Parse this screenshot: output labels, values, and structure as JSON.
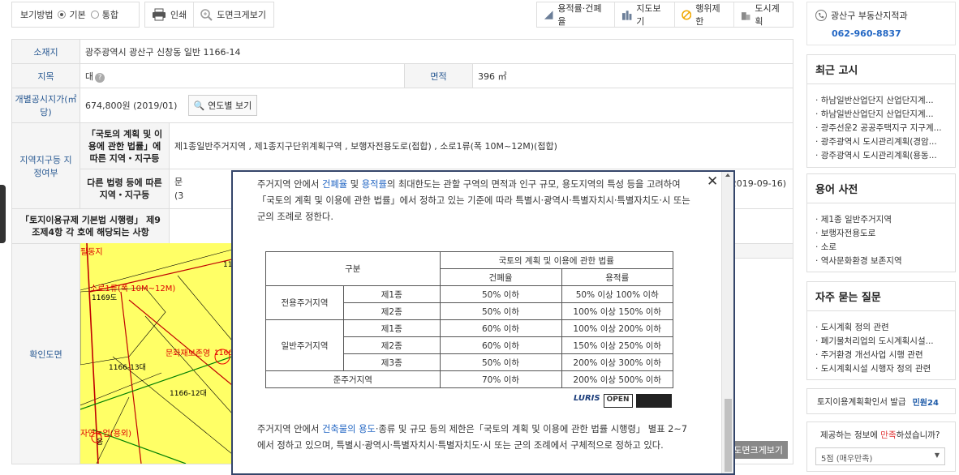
{
  "toolbar": {
    "view_mode_label": "보기방법",
    "view_basic": "기본",
    "view_combined": "통합",
    "print": "인쇄",
    "map_zoom": "도면크게보기",
    "calc": "용적률·건폐율",
    "map_view": "지도보기",
    "restriction": "행위제한",
    "city_plan": "도시계획"
  },
  "info": {
    "location_label": "소재지",
    "location_value": "광주광역시 광산구 신창동 일반 1166-14",
    "jimok_label": "지목",
    "jimok_value": "대",
    "area_label": "면적",
    "area_value": "396 ㎡",
    "price_label": "개별공시지가(㎡ 당)",
    "price_value": "674,800원 (2019/01)",
    "yearly_btn": "연도별 보기",
    "zone_label": "지역지구등 지정여부",
    "law1_label": "「국토의 계획 및 이용에 관한 법률」에 따른 지역・지구등",
    "law1_value": "제1종일반주거지역 , 제1종지구단위계획구역 , 보행자전용도로(접합) , 소로1류(폭 10M~12M)(접합)",
    "law2_label": "다른 법령 등에 따른 지역・지구등",
    "law2_value_a": "문",
    "law2_value_b": "(3",
    "law2_date": "2019-09-16)",
    "decree_label": "「토지이용규제 기본법 시행령」 제9조제4항 각 호에 해당되는 사항",
    "confirm_map_label": "확인도면",
    "map_zoom_btn": "도면크게보기"
  },
  "map_labels": {
    "a": "필동지",
    "b": "소로1류(폭 10M~12M)",
    "c": "1169도",
    "d": "1166-13대",
    "e": "1166-12대",
    "f": "문화재보존영",
    "g": "11",
    "h": "1166",
    "i": "자연녹업(용외)",
    "j": "응"
  },
  "modal": {
    "close_label": "✕",
    "p1_a": "주거지역 안에서 ",
    "p1_b": "건폐율",
    "p1_c": " 및 ",
    "p1_d": "용적률",
    "p1_e": "의 최대한도는 관할 구역의 면적과 인구 규모, 용도지역의 특성 등을 고려하여「국토의 계획 및 이용에 관한 법률」에서 정하고 있는 기준에 따라 특별시·광역시·특별자치시·특별자치도·시 또는 군의 조례로 정한다.",
    "table": {
      "h_category": "구분",
      "h_law": "국토의 계획 및 이용에 관한 법률",
      "h_bcr": "건폐율",
      "h_far": "용적률",
      "rows": [
        {
          "group": "전용주거지역",
          "sub": "제1종",
          "bcr": "50% 이하",
          "far": "50% 이상 100% 이하"
        },
        {
          "group": "",
          "sub": "제2종",
          "bcr": "50% 이하",
          "far": "100% 이상 150% 이하"
        },
        {
          "group": "일반주거지역",
          "sub": "제1종",
          "bcr": "60% 이하",
          "far": "100% 이상 200% 이하"
        },
        {
          "group": "",
          "sub": "제2종",
          "bcr": "60% 이하",
          "far": "150% 이상 250% 이하"
        },
        {
          "group": "",
          "sub": "제3종",
          "bcr": "50% 이하",
          "far": "200% 이상 300% 이하"
        },
        {
          "group": "준주거지역",
          "sub": "",
          "bcr": "70% 이하",
          "far": "200% 이상 500% 이하"
        }
      ]
    },
    "logo_luris": "LURIS",
    "logo_open": "OPEN",
    "p2_a": "주거지역 안에서 ",
    "p2_b": "건축물의 용도",
    "p2_c": "·종류 및 규모 등의 제한은「국토의 계획 및 이용에 관한 법률 시행령」 별표 2~7에서 정하고 있으며, 특별시·광역시·특별자치시·특별자치도·시 또는 군의 조례에서 구체적으로 정하고 있다."
  },
  "sidebar": {
    "office_name": "광산구 부동산지적과",
    "office_phone": "062-960-8837",
    "notice_title": "최근 고시",
    "notices": [
      "하남일반산업단지 산업단지계...",
      "하남일반산업단지 산업단지계...",
      "광주선운2 공공주택지구 지구계...",
      "광주광역시 도시관리계획(경암...",
      "광주광역시 도시관리계획(용동..."
    ],
    "dict_title": "용어 사전",
    "dict_items": [
      "제1종 일반주거지역",
      "보행자전용도로",
      "소로",
      "역사문화환경 보존지역"
    ],
    "faq_title": "자주 묻는 질문",
    "faq_items": [
      "도시계획 정의 관련",
      "폐기물처리업의 도시계획시설...",
      "주거환경 개선사업 시행 관련",
      "도시계획시설 시행자 정의 관련"
    ],
    "issue_label": "토지이용계획확인서 발급",
    "minwon_logo": "민원24",
    "survey_q_a": "제공하는 정보에 ",
    "survey_q_b": "만족",
    "survey_q_c": "하셨습니까?",
    "survey_selected": "5점 (매우만족)"
  },
  "colors": {
    "accent_blue": "#2367c4",
    "header_blue": "#2a5a93",
    "map_yellow": "#ffff66",
    "modal_border": "#34456a"
  }
}
